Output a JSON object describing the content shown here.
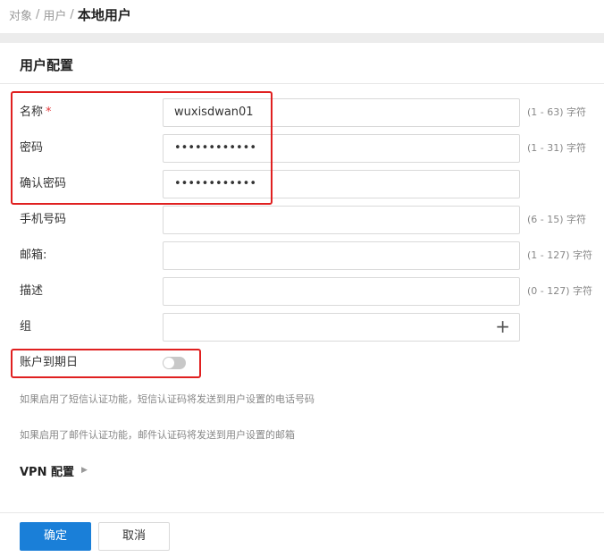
{
  "breadcrumb": {
    "items": [
      "对象",
      "用户"
    ],
    "separator": "/",
    "current": "本地用户"
  },
  "panel": {
    "title": "用户配置"
  },
  "form": {
    "name": {
      "label": "名称",
      "required_mark": "*",
      "value": "wuxisdwan01",
      "hint": "(1 - 63) 字符"
    },
    "password": {
      "label": "密码",
      "value": "••••••••••••",
      "hint": "(1 - 31) 字符"
    },
    "confirm_password": {
      "label": "确认密码",
      "value": "••••••••••••"
    },
    "phone": {
      "label": "手机号码",
      "value": "",
      "hint": "(6 - 15) 字符"
    },
    "email": {
      "label": "邮箱:",
      "value": "",
      "hint": "(1 - 127) 字符"
    },
    "description": {
      "label": "描述",
      "value": "",
      "hint": "(0 - 127) 字符"
    },
    "group": {
      "label": "组",
      "value": "",
      "add_symbol": "+"
    },
    "expiry": {
      "label": "账户到期日",
      "enabled": false
    }
  },
  "notes": {
    "sms": "如果启用了短信认证功能，短信认证码将发送到用户设置的电话号码",
    "mail": "如果启用了邮件认证功能，邮件认证码将发送到用户设置的邮箱"
  },
  "vpn": {
    "label": "VPN 配置",
    "caret": "▶"
  },
  "footer": {
    "confirm_label": "确定",
    "cancel_label": "取消"
  },
  "colors": {
    "primary": "#1a7fd8",
    "highlight": "#e02020",
    "required": "#e4393c"
  }
}
